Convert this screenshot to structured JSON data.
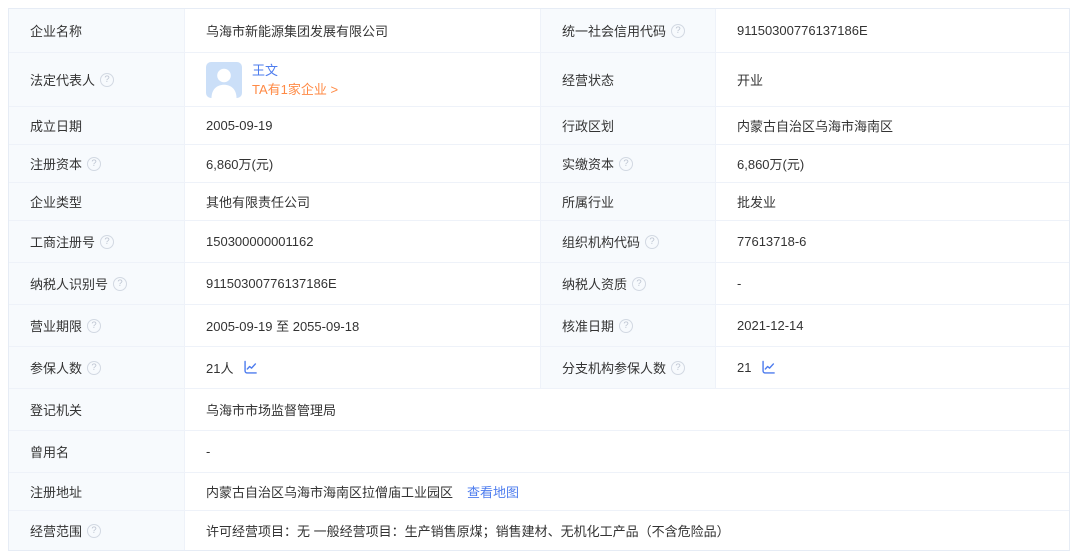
{
  "icons": {
    "help": "?",
    "trend": "line-chart",
    "avatar": "person-silhouette"
  },
  "colors": {
    "link_blue": "#4d7cee",
    "accent_orange": "#ff8a45",
    "label_bg": "#f7fafd",
    "border": "#e6ecf5",
    "text": "#333333",
    "avatar_bg": "#cbdff8"
  },
  "f": {
    "company_name": {
      "label": "企业名称",
      "value": "乌海市新能源集团发展有限公司"
    },
    "credit_code": {
      "label": "统一社会信用代码",
      "value": "91150300776137186E"
    },
    "legal_rep": {
      "label": "法定代表人",
      "person": "王文",
      "related": "TA有1家企业 >"
    },
    "status": {
      "label": "经营状态",
      "value": "开业"
    },
    "establish_date": {
      "label": "成立日期",
      "value": "2005-09-19"
    },
    "admin_division": {
      "label": "行政区划",
      "value": "内蒙古自治区乌海市海南区"
    },
    "reg_capital": {
      "label": "注册资本",
      "value": "6,860万(元)"
    },
    "paid_capital": {
      "label": "实缴资本",
      "value": "6,860万(元)"
    },
    "company_type": {
      "label": "企业类型",
      "value": "其他有限责任公司"
    },
    "industry": {
      "label": "所属行业",
      "value": "批发业"
    },
    "reg_number": {
      "label": "工商注册号",
      "value": "150300000001162"
    },
    "org_code": {
      "label": "组织机构代码",
      "value": "77613718-6"
    },
    "taxpayer_id": {
      "label": "纳税人识别号",
      "value": "91150300776137186E"
    },
    "taxpayer_quality": {
      "label": "纳税人资质",
      "value": "-"
    },
    "business_term": {
      "label": "营业期限",
      "value": "2005-09-19 至 2055-09-18"
    },
    "approval_date": {
      "label": "核准日期",
      "value": "2021-12-14"
    },
    "insured": {
      "label": "参保人数",
      "value": "21人"
    },
    "branch_insured": {
      "label": "分支机构参保人数",
      "value": "21"
    },
    "reg_authority": {
      "label": "登记机关",
      "value": "乌海市市场监督管理局"
    },
    "former_name": {
      "label": "曾用名",
      "value": "-"
    },
    "address": {
      "label": "注册地址",
      "value": "内蒙古自治区乌海市海南区拉僧庙工业园区",
      "map_link": "查看地图"
    },
    "scope": {
      "label": "经营范围",
      "value": "许可经营项目：无 一般经营项目：生产销售原煤；销售建材、无机化工产品（不含危险品）"
    }
  }
}
